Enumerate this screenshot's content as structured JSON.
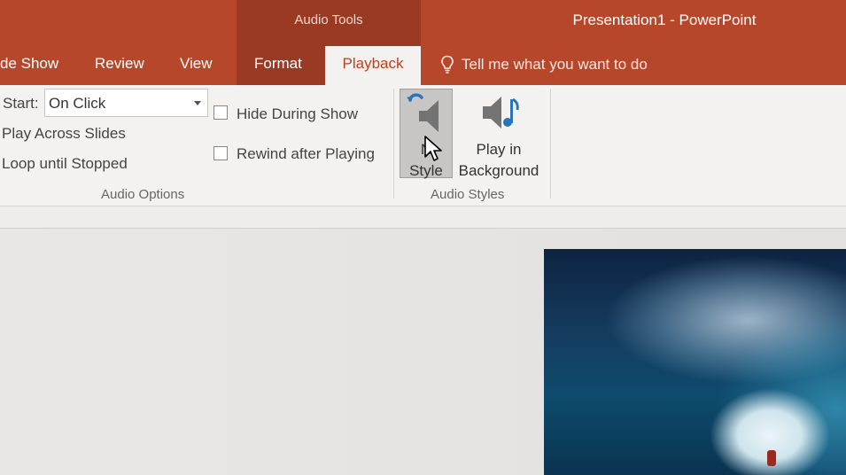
{
  "titlebar": {
    "context_group": "Audio Tools",
    "app_title": "Presentation1 - PowerPoint"
  },
  "tabs": {
    "slide_show": "de Show",
    "review": "Review",
    "view": "View",
    "format": "Format",
    "playback": "Playback",
    "tell_me": "Tell me what you want to do"
  },
  "ribbon": {
    "audio_options": {
      "start_label": "Start:",
      "start_value": "On Click",
      "play_across": "Play Across Slides",
      "loop": "Loop until Stopped",
      "hide_during_show": "Hide During Show",
      "rewind_after_playing": "Rewind after Playing",
      "group_label": "Audio Options"
    },
    "audio_styles": {
      "no_style_line1": "N",
      "no_style_line2": "Style",
      "bg_line1": "Play in",
      "bg_line2": "Background",
      "group_label": "Audio Styles"
    }
  },
  "colors": {
    "brand": "#b7472a",
    "context_tab": "#9b3a23",
    "active_tab_text": "#c43e1c",
    "ribbon_bg": "#f3f2f1"
  },
  "icons": [
    "lightbulb-icon",
    "no-style-speaker-icon",
    "play-in-background-icon",
    "dropdown-caret-icon",
    "mouse-cursor-icon"
  ]
}
